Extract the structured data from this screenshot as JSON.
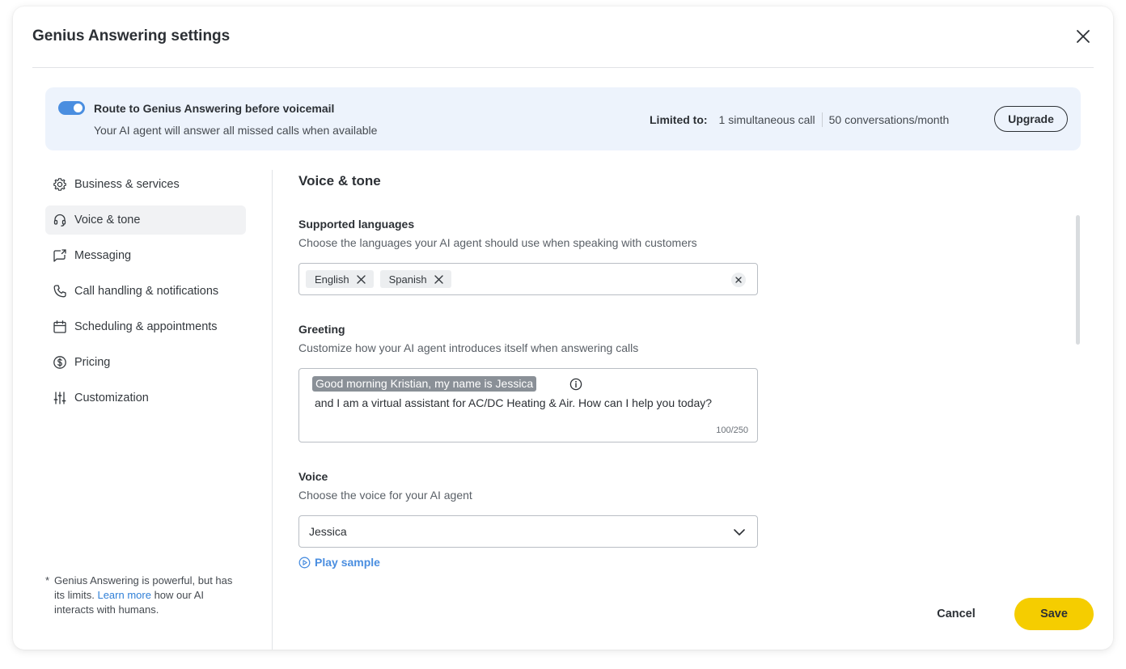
{
  "modal": {
    "title": "Genius Answering settings"
  },
  "banner": {
    "toggle_on": true,
    "title": "Route to Genius Answering before voicemail",
    "subtitle": "Your AI agent will answer all missed calls when available",
    "limits_label": "Limited to:",
    "limit_calls": "1 simultaneous call",
    "limit_conversations": "50 conversations/month",
    "upgrade_label": "Upgrade"
  },
  "sidebar": {
    "items": [
      {
        "label": "Business & services",
        "icon": "gear-icon"
      },
      {
        "label": "Voice & tone",
        "icon": "headset-icon",
        "active": true
      },
      {
        "label": "Messaging",
        "icon": "message-icon"
      },
      {
        "label": "Call handling & notifications",
        "icon": "phone-icon"
      },
      {
        "label": "Scheduling & appointments",
        "icon": "calendar-icon"
      },
      {
        "label": "Pricing",
        "icon": "dollar-icon"
      },
      {
        "label": "Customization",
        "icon": "sliders-icon"
      }
    ],
    "note": {
      "star": "*",
      "before": "Genius Answering is powerful, but has its limits.",
      "link": "Learn more",
      "after": "how our AI interacts with humans."
    }
  },
  "content": {
    "section_title": "Voice & tone",
    "languages": {
      "label": "Supported languages",
      "description": "Choose the languages your AI agent should use when speaking with customers",
      "selected": [
        "English",
        "Spanish"
      ]
    },
    "greeting": {
      "label": "Greeting",
      "description": "Customize how your AI agent introduces itself when answering calls",
      "variable_text": "Good morning Kristian, my name is Jessica",
      "text": "and I am a virtual assistant for AC/DC Heating & Air. How can I help you today?",
      "counter": "100/250"
    },
    "voice": {
      "label": "Voice",
      "description": "Choose the voice for your AI agent",
      "selected": "Jessica",
      "play_sample": "Play sample"
    }
  },
  "footer": {
    "cancel_label": "Cancel",
    "save_label": "Save"
  },
  "colors": {
    "accent_blue": "#4a8ee0",
    "save_yellow": "#f5cd00",
    "banner_bg": "#edf3fc",
    "link_blue": "#2f7fd7"
  }
}
